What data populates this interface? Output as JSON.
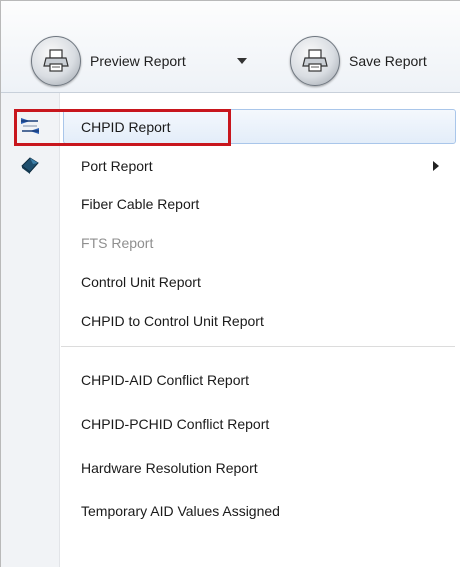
{
  "toolbar": {
    "preview_label": "Preview Report",
    "save_label": "Save Report"
  },
  "menu": {
    "items": [
      {
        "label": "CHPID Report",
        "state": "highlighted",
        "icon": "chpid-report-icon"
      },
      {
        "label": "Port Report",
        "has_submenu": true,
        "icon": "port-report-icon"
      },
      {
        "label": "Fiber Cable Report"
      },
      {
        "label": "FTS Report",
        "state": "disabled"
      },
      {
        "label": "Control Unit Report"
      },
      {
        "label": "CHPID to Control Unit Report"
      },
      {
        "label": "CHPID-AID Conflict Report"
      },
      {
        "label": "CHPID-PCHID Conflict Report"
      },
      {
        "label": "Hardware Resolution Report"
      },
      {
        "label": "Temporary AID Values Assigned"
      }
    ]
  },
  "annotation": {
    "highlight_color": "#c8161d"
  }
}
